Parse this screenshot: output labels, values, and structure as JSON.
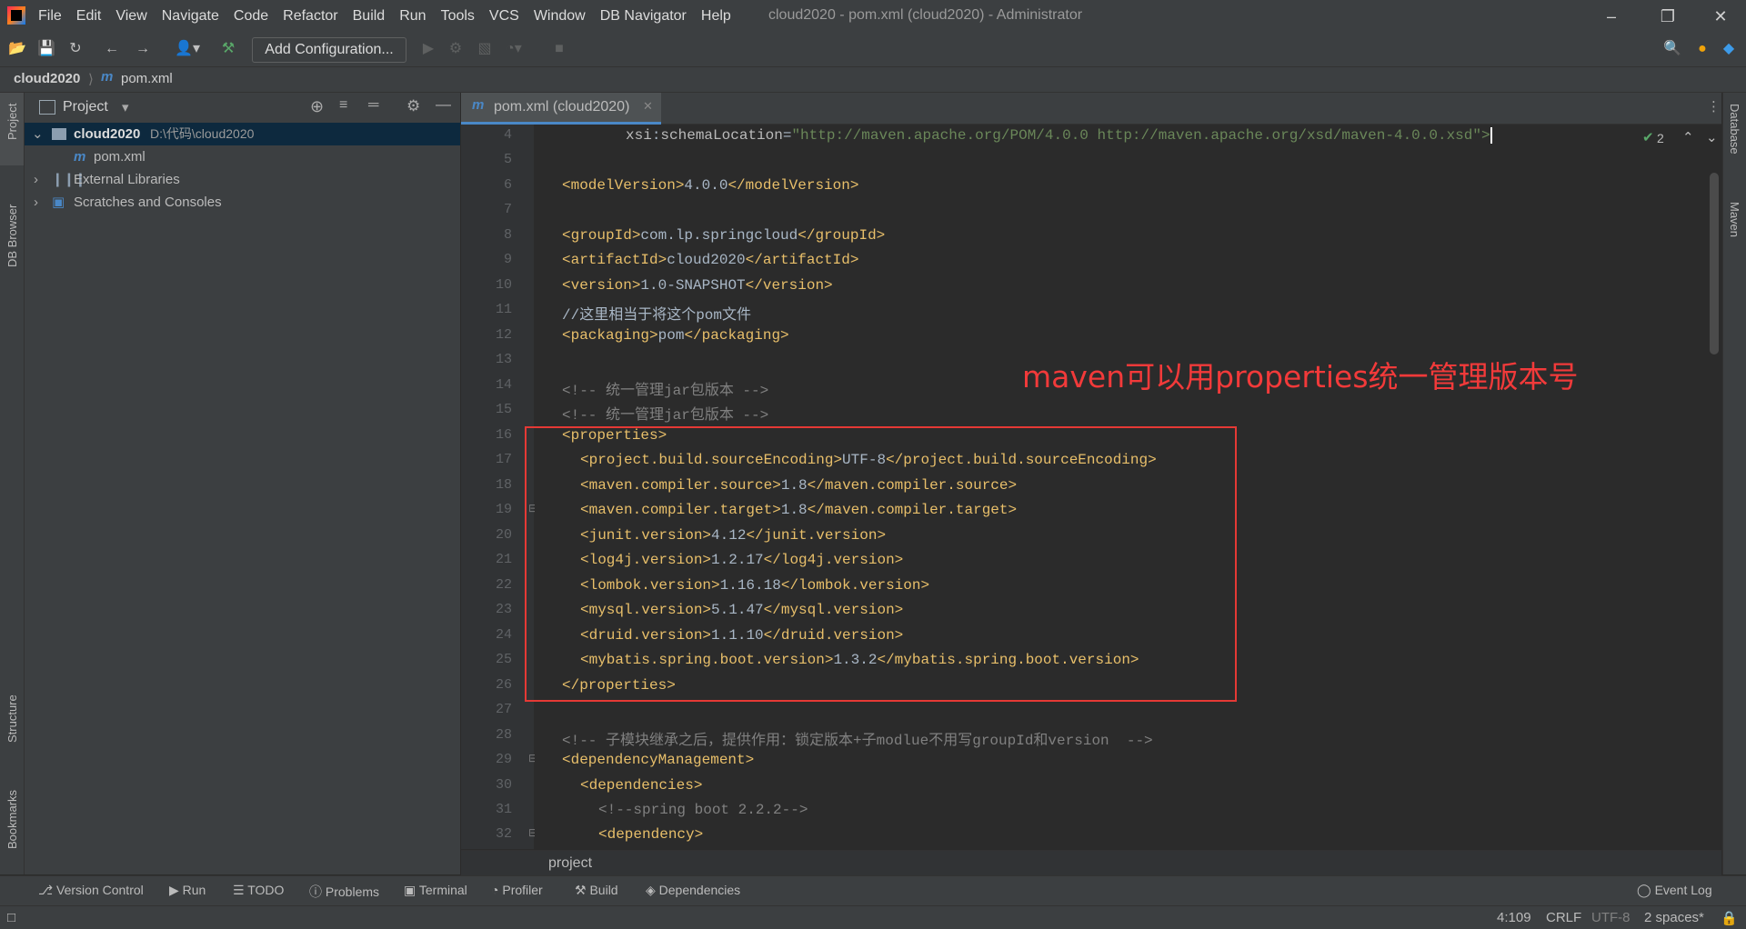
{
  "window": {
    "title": "cloud2020 - pom.xml (cloud2020) - Administrator",
    "menu": [
      "File",
      "Edit",
      "View",
      "Navigate",
      "Code",
      "Refactor",
      "Build",
      "Run",
      "Tools",
      "VCS",
      "Window",
      "DB Navigator",
      "Help"
    ]
  },
  "toolbar": {
    "add_configuration": "Add Configuration..."
  },
  "breadcrumb": {
    "project": "cloud2020",
    "file": "pom.xml"
  },
  "left_stripe": {
    "project": "Project",
    "db_browser": "DB Browser",
    "structure": "Structure",
    "bookmarks": "Bookmarks"
  },
  "right_stripe": {
    "database": "Database",
    "maven": "Maven"
  },
  "project_panel": {
    "title": "Project",
    "tree": [
      {
        "label": "cloud2020",
        "path": "D:\\代码\\cloud2020"
      },
      {
        "label": "pom.xml"
      },
      {
        "label": "External Libraries"
      },
      {
        "label": "Scratches and Consoles"
      }
    ]
  },
  "editor": {
    "tab": "pom.xml (cloud2020)",
    "inspection_count": "2",
    "line_numbers": [
      "4",
      "5",
      "6",
      "7",
      "8",
      "9",
      "10",
      "11",
      "12",
      "13",
      "14",
      "15",
      "16",
      "17",
      "18",
      "19",
      "20",
      "21",
      "22",
      "23",
      "24",
      "25",
      "26",
      "27",
      "28",
      "29",
      "30",
      "31",
      "32"
    ],
    "annotation": "maven可以用properties统一管理版本号",
    "breadcrumb": "project"
  },
  "tool_windows": [
    "Version Control",
    "Run",
    "TODO",
    "Problems",
    "Terminal",
    "Profiler",
    "Build",
    "Dependencies"
  ],
  "event_log": "Event Log",
  "status": {
    "position": "4:109",
    "line_sep": "CRLF",
    "encoding": "UTF-8",
    "indent": "2 spaces*"
  }
}
